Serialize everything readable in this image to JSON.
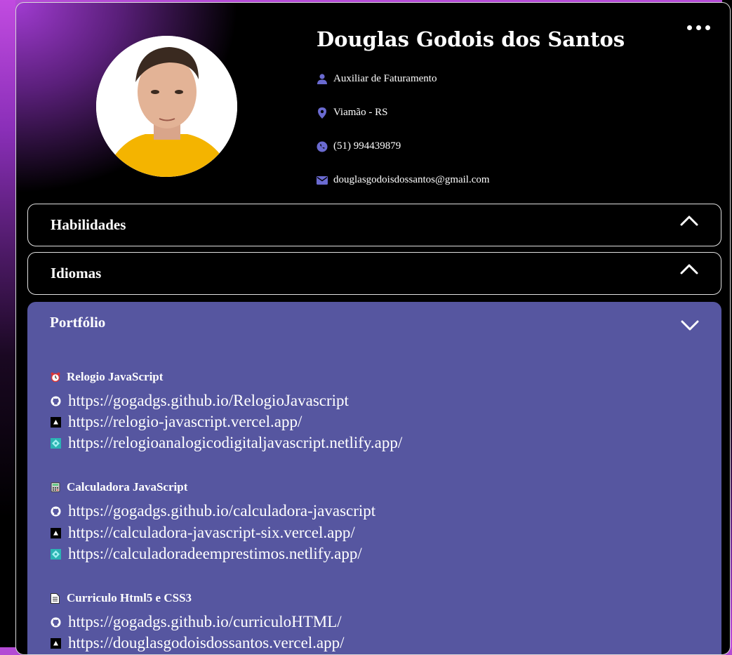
{
  "profile": {
    "name": "Douglas Godois dos Santos",
    "role": "Auxiliar de Faturamento",
    "location": "Viamão - RS",
    "phone": "(51) 994439879",
    "email": "douglasgodoisdossantos@gmail.com"
  },
  "sections": {
    "skills": "Habilidades",
    "languages": "Idiomas",
    "portfolio": "Portfólio"
  },
  "projects": [
    {
      "icon": "alarm-clock-icon",
      "title": "Relogio JavaScript",
      "links": [
        {
          "icon": "github-icon",
          "url": "https://gogadgs.github.io/RelogioJavascript"
        },
        {
          "icon": "vercel-icon",
          "url": "https://relogio-javascript.vercel.app/"
        },
        {
          "icon": "netlify-icon",
          "url": "https://relogioanalogicodigitaljavascript.netlify.app/"
        }
      ]
    },
    {
      "icon": "calculator-icon",
      "title": "Calculadora JavaScript",
      "links": [
        {
          "icon": "github-icon",
          "url": "https://gogadgs.github.io/calculadora-javascript"
        },
        {
          "icon": "vercel-icon",
          "url": "https://calculadora-javascript-six.vercel.app/"
        },
        {
          "icon": "netlify-icon",
          "url": "https://calculadoradeemprestimos.netlify.app/"
        }
      ]
    },
    {
      "icon": "document-icon",
      "title": "Curriculo Html5 e CSS3",
      "links": [
        {
          "icon": "github-icon",
          "url": "https://gogadgs.github.io/curriculoHTML/"
        },
        {
          "icon": "vercel-icon",
          "url": "https://douglasgodoisdossantos.vercel.app/"
        }
      ]
    }
  ],
  "colors": {
    "accent": "#5656a0",
    "icon_accent": "#6a6ad0",
    "background": "#000000"
  }
}
